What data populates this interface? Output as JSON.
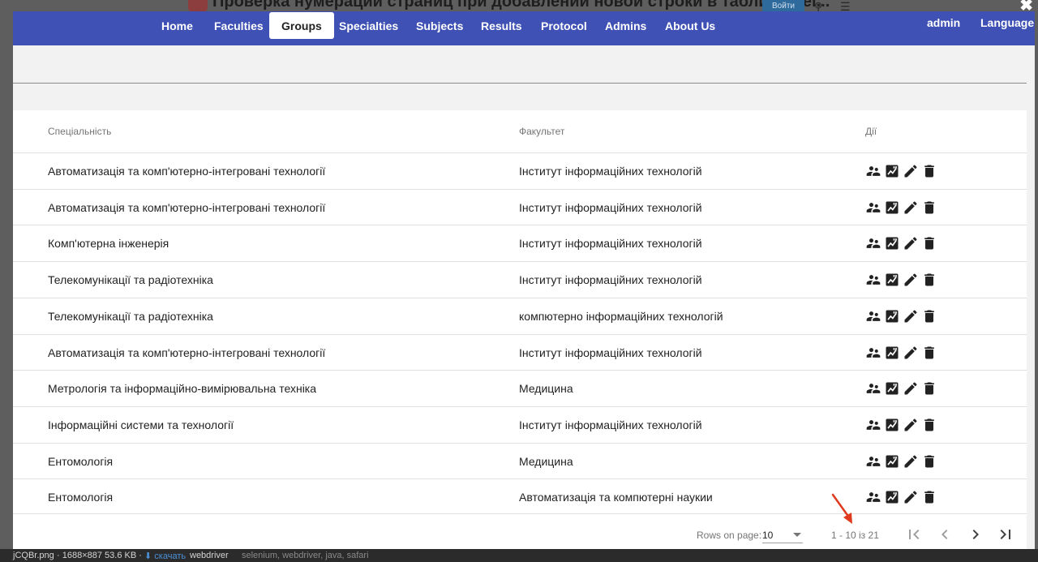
{
  "background": {
    "title": "Проверка нумерации страниц при добавлении новой строки в таблицу Sel...",
    "login": "Войти"
  },
  "lightbox": {
    "footer": {
      "filename": "jCQBr.png",
      "info": "· 1688×887 53.6 KB ·",
      "download": "скачать",
      "tag_main": "webdriver",
      "tags": "selenium, webdriver, java, safari"
    }
  },
  "nav": {
    "items": [
      "Home",
      "Faculties",
      "Groups",
      "Specialties",
      "Subjects",
      "Results",
      "Protocol",
      "Admins",
      "About Us"
    ],
    "active": "Groups",
    "user": "admin",
    "language": "Language"
  },
  "table": {
    "headers": {
      "specialty": "Спеціальність",
      "faculty": "Факультет",
      "actions": "Дії"
    },
    "rows": [
      {
        "specialty": "Автоматизація та комп'ютерно-інтегровані технології",
        "faculty": "Інститут інформаційних технологій"
      },
      {
        "specialty": "Автоматизація та комп'ютерно-інтегровані технології",
        "faculty": "Інститут інформаційних технологій"
      },
      {
        "specialty": "Комп'ютерна інженерія",
        "faculty": "Інститут інформаційних технологій"
      },
      {
        "specialty": "Телекомунікації та радіотехніка",
        "faculty": "Інститут інформаційних технологій"
      },
      {
        "specialty": "Телекомунікації та радіотехніка",
        "faculty": "компютерно інформаційних технологій"
      },
      {
        "specialty": "Автоматизація та комп'ютерно-інтегровані технології",
        "faculty": "Інститут інформаційних технологій"
      },
      {
        "specialty": "Метрологія та інформаційно-вимірювальна техніка",
        "faculty": "Медицина"
      },
      {
        "specialty": "Інформаційні системи та технології",
        "faculty": "Інститут інформаційних технологій"
      },
      {
        "specialty": "Ентомологія",
        "faculty": "Медицина"
      },
      {
        "specialty": "Ентомологія",
        "faculty": "Автоматизація та компютерні наукии"
      }
    ],
    "row_actions": [
      "students-icon",
      "results-icon",
      "edit-icon",
      "delete-icon"
    ]
  },
  "paginator": {
    "rows_label": "Rows on page:",
    "rows_value": "10",
    "range": "1 - 10 із 21",
    "buttons": [
      "first-page-icon",
      "previous-page-icon",
      "next-page-icon",
      "last-page-icon"
    ]
  },
  "colors": {
    "navbar": "#3f51b5",
    "arrow": "#e03a1e"
  }
}
